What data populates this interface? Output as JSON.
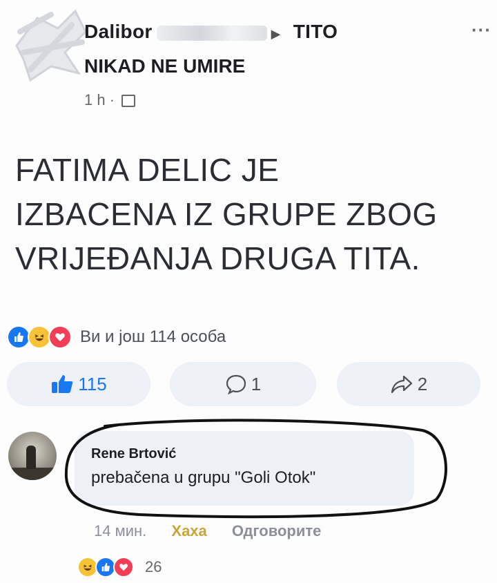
{
  "post": {
    "author": "Dalibor",
    "group": "TITO",
    "subtitle": "NIKAD NE UMIRE",
    "time": "1 h ·",
    "lines": [
      "FATIMA DELIC JE",
      "IZBACENA IZ GRUPE ZBOG",
      "VRIJEĐANJA DRUGA TITA."
    ]
  },
  "reactions": {
    "summary": "Ви и још 114 особа",
    "icons": [
      "like-icon",
      "haha-icon",
      "love-icon"
    ]
  },
  "actions": {
    "like_count": "115",
    "comment_count": "1",
    "share_count": "2"
  },
  "comment": {
    "name": "Rene Brtović",
    "text": "prebačena u grupu \"Goli Otok\"",
    "time": "14 мин.",
    "haha_label": "Хаха",
    "reply_label": "Одговорите",
    "reaction_count": "26"
  },
  "colors": {
    "accent": "#1877f2",
    "haha": "#f7c236",
    "love": "#f33e58",
    "bubble": "#edf0f6"
  }
}
